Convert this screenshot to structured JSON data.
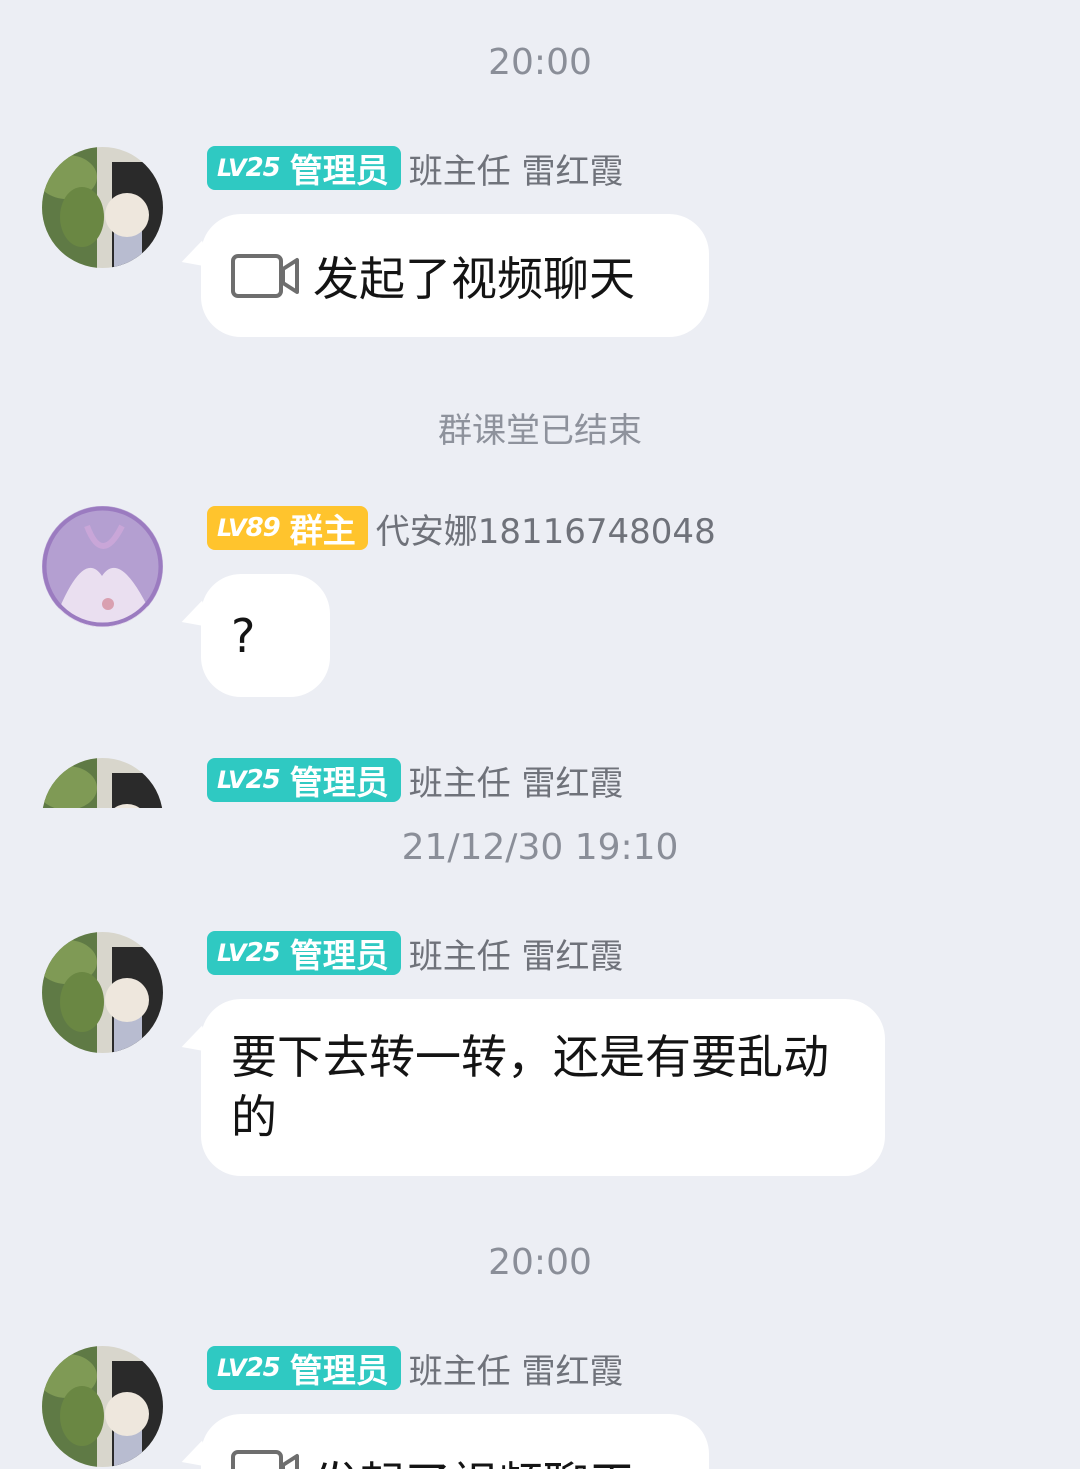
{
  "timestamps": [
    "20:00",
    "21/12/30 19:10",
    "20:00"
  ],
  "system_messages": [
    "群课堂已结束"
  ],
  "messages": [
    {
      "level_prefix": "LV",
      "level_num": "25",
      "role": "管理员",
      "sender": "班主任 雷红霞",
      "text": "发起了视频聊天",
      "icon": "video-camera-icon"
    },
    {
      "level_prefix": "LV",
      "level_num": "89",
      "role": "群主",
      "sender": "代安娜18116748048",
      "text": "?"
    },
    {
      "level_prefix": "LV",
      "level_num": "25",
      "role": "管理员",
      "sender": "班主任 雷红霞"
    },
    {
      "level_prefix": "LV",
      "level_num": "25",
      "role": "管理员",
      "sender": "班主任 雷红霞",
      "text": "要下去转一转，还是有要乱动的"
    },
    {
      "level_prefix": "LV",
      "level_num": "25",
      "role": "管理员",
      "sender": "班主任 雷红霞",
      "text": "发起了视频聊天",
      "icon": "video-camera-icon"
    }
  ],
  "colors": {
    "background": "#eceef4",
    "admin_badge": "#2fc9c2",
    "owner_badge": "#ffc42d",
    "bubble": "#ffffff",
    "timestamp": "#8a8e98"
  }
}
